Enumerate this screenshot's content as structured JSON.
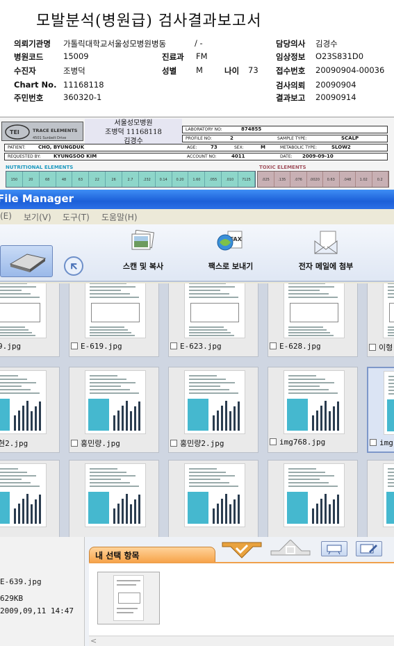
{
  "report": {
    "title": "모발분석(병원급) 검사결과보고서",
    "fields": {
      "institution": {
        "label": "의뢰기관명",
        "value": "가톨릭대학교서울성모병원병동",
        "extra": "/ -"
      },
      "doctor": {
        "label": "담당의사",
        "value": "김경수"
      },
      "hospital_code": {
        "label": "병원코드",
        "value": "15009"
      },
      "department": {
        "label": "진료과",
        "value": "FM"
      },
      "clinical_info": {
        "label": "임상정보",
        "value": "O23S831D0"
      },
      "patient": {
        "label": "수진자",
        "value": "조병덕"
      },
      "sex": {
        "label": "성별",
        "value": "M"
      },
      "age": {
        "label": "나이",
        "value": "73"
      },
      "receipt_no": {
        "label": "접수번호",
        "value": "20090904-00036"
      },
      "chart_no": {
        "label": "Chart No.",
        "value": "11168118"
      },
      "test_request": {
        "label": "검사의뢰",
        "value": "20090904"
      },
      "resident_no": {
        "label": "주민번호",
        "value": "360320-1"
      },
      "result_report": {
        "label": "결과보고",
        "value": "20090914"
      }
    }
  },
  "scan": {
    "lab_name": "TRACE ELEMENTS",
    "lab_addr": "4501 Sunbelt Drive",
    "stamp_lines": [
      "서울성모병원",
      "조병덕 11168118",
      "김경수"
    ],
    "lab_no_label": "LABORATORY NO:",
    "lab_no": "874855",
    "profile_label": "PROFILE NO:",
    "profile_no": "2",
    "sample_label": "SAMPLE TYPE:",
    "sample_type": "SCALP",
    "patient_label": "PATIENT:",
    "patient": "CHO, BYUNGDUK",
    "age_label": "AGE:",
    "age": "73",
    "sex_label": "SEX:",
    "sex": "M",
    "metabolic_label": "METABOLIC TYPE:",
    "metabolic_type": "SLOW2",
    "requested_label": "REQUESTED BY:",
    "requested_by": "KYUNGSOO KIM",
    "account_label": "ACCOUNT NO:",
    "account_no": "4011",
    "date_label": "DATE:",
    "date": "2009-09-10",
    "nutritional_label": "NUTRITIONAL ELEMENTS",
    "toxic_label": "TOXIC ELEMENTS",
    "nutri_values": [
      "150",
      "20",
      "68",
      "48",
      "63",
      "22",
      "26",
      "2.7",
      ".232",
      "0.14",
      "0.20",
      "1.60",
      ".055",
      ".010",
      "7125"
    ],
    "toxic_values": [
      ".025",
      ".135",
      ".076",
      ".0020",
      "0.63",
      ".048",
      "1.02",
      "0.2"
    ]
  },
  "window": {
    "title": "File Manager",
    "menu": [
      "(E)",
      "보기(V)",
      "도구(T)",
      "도움말(H)"
    ],
    "toolbar": {
      "scan_copy": "스캔 및 복사",
      "fax_send": "팩스로 보내기",
      "email_attach": "전자 메일에 첨부"
    },
    "files": [
      {
        "name": "9.jpg"
      },
      {
        "name": "E-619.jpg"
      },
      {
        "name": "E-623.jpg"
      },
      {
        "name": "E-628.jpg"
      },
      {
        "name": "이형"
      },
      {
        "name": "현2.jpg"
      },
      {
        "name": "홍민량.jpg"
      },
      {
        "name": "홍민량2.jpg"
      },
      {
        "name": "img768.jpg"
      },
      {
        "name": "img"
      },
      {
        "name": ""
      },
      {
        "name": ""
      },
      {
        "name": ""
      },
      {
        "name": ""
      },
      {
        "name": ""
      }
    ],
    "info": {
      "line1": "E-639.jpg",
      "line2": "629KB",
      "line3": "2009,09,11 14:47"
    },
    "selection_tab": "내 선택 항목"
  }
}
